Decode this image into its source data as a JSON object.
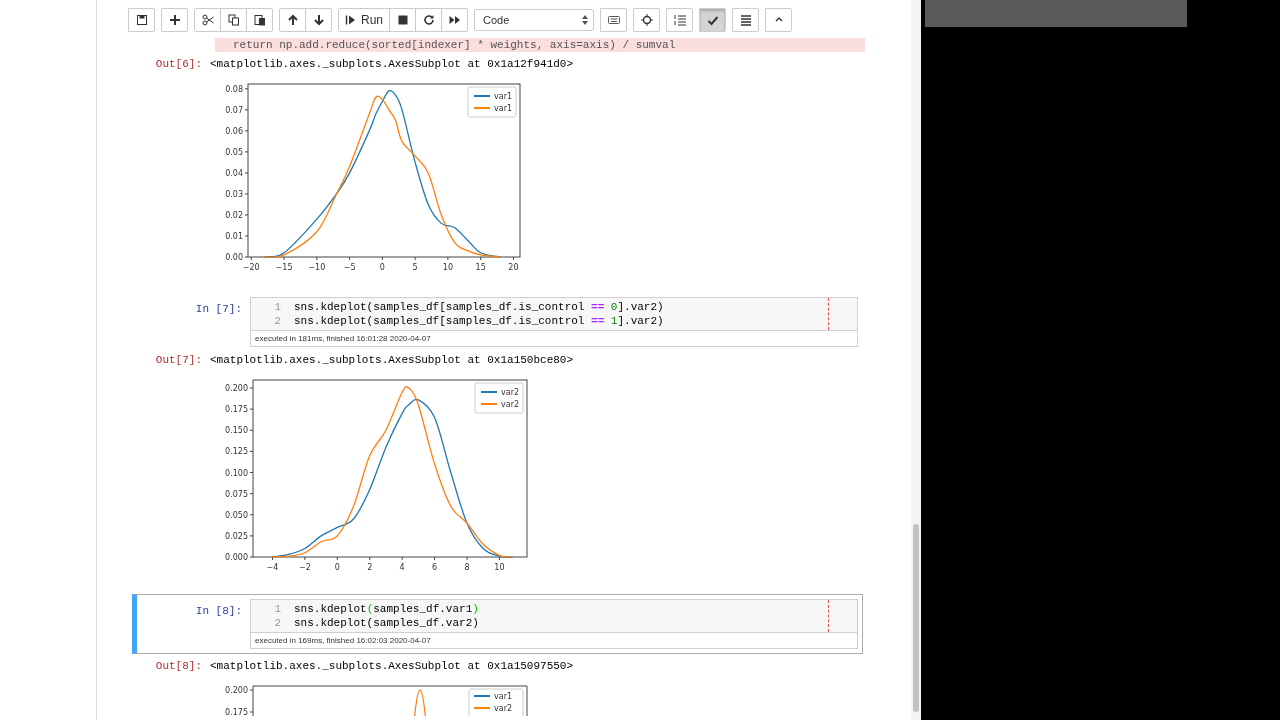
{
  "toolbar": {
    "groups": [
      {
        "buttons": [
          {
            "kind": "save",
            "active": false
          }
        ]
      },
      {
        "buttons": [
          {
            "kind": "add",
            "active": false
          }
        ]
      },
      {
        "buttons": [
          {
            "kind": "cut",
            "active": false
          },
          {
            "kind": "copy",
            "active": false
          },
          {
            "kind": "paste",
            "active": false
          }
        ]
      },
      {
        "buttons": [
          {
            "kind": "up",
            "active": false
          },
          {
            "kind": "down",
            "active": false
          }
        ]
      },
      {
        "buttons": [
          {
            "kind": "run",
            "label": "Run",
            "active": false
          },
          {
            "kind": "stop",
            "active": false
          },
          {
            "kind": "restart",
            "active": false
          },
          {
            "kind": "fast-forward",
            "active": false
          }
        ]
      }
    ],
    "cell_type": "Code",
    "extra_buttons": [
      {
        "kind": "keyboard",
        "active": false
      },
      {
        "kind": "crosshair",
        "active": false
      },
      {
        "kind": "list",
        "active": false
      },
      {
        "kind": "spellcheck",
        "active": true
      },
      {
        "kind": "toc",
        "active": false
      },
      {
        "kind": "collapse",
        "active": false
      }
    ]
  },
  "webcam": {
    "kind": "video"
  },
  "cells": [
    {
      "kind": "output",
      "warning": "return np.add.reduce(sorted[indexer] * weights, axis=axis) / sumval",
      "prompt": "Out[6]:",
      "text": "<matplotlib.axes._subplots.AxesSubplot at 0x1a12f941d0>",
      "chart_data": {
        "type": "line",
        "x": [
          -18,
          -15,
          -10,
          -7,
          -5,
          -2,
          -1,
          0,
          1,
          2,
          3,
          5,
          7,
          9,
          11,
          13,
          15,
          18
        ],
        "xlim": [
          -20.5,
          21
        ],
        "ylim": [
          0,
          0.0823
        ],
        "xticks": [
          -20,
          -15,
          -10,
          -5,
          0,
          5,
          10,
          15,
          20
        ],
        "yticks": [
          {
            "value": 0,
            "label": "0.00"
          },
          {
            "value": 0.01,
            "label": "0.01"
          },
          {
            "value": 0.02,
            "label": "0.02"
          },
          {
            "value": 0.03,
            "label": "0.03"
          },
          {
            "value": 0.04,
            "label": "0.04"
          },
          {
            "value": 0.05,
            "label": "0.05"
          },
          {
            "value": 0.06,
            "label": "0.06"
          },
          {
            "value": 0.07,
            "label": "0.07"
          },
          {
            "value": 0.08,
            "label": "0.08"
          }
        ],
        "series": [
          {
            "name": "var1",
            "color": "#1f77b4",
            "values": [
              0,
              0.002,
              0.018,
              0.03,
              0.04,
              0.06,
              0.068,
              0.074,
              0.079,
              0.077,
              0.07,
              0.045,
              0.025,
              0.016,
              0.014,
              0.008,
              0.002,
              0
            ]
          },
          {
            "name": "var1",
            "color": "#ff7f0e",
            "values": [
              0,
              0.001,
              0.012,
              0.03,
              0.043,
              0.068,
              0.076,
              0.075,
              0.07,
              0.065,
              0.055,
              0.048,
              0.04,
              0.02,
              0.007,
              0.003,
              0.001,
              0
            ]
          }
        ]
      }
    },
    {
      "kind": "code",
      "selected": false,
      "prompt": "In [7]:",
      "lines": [
        {
          "number": "1",
          "tokens": [
            {
              "kind": "plain",
              "text": "sns.kdeplot(samples_df[samples_df.is_control "
            },
            {
              "kind": "operator",
              "text": "=="
            },
            {
              "kind": "number",
              "text": " 0"
            },
            {
              "kind": "plain",
              "text": "].var2)"
            }
          ]
        },
        {
          "number": "2",
          "tokens": [
            {
              "kind": "plain",
              "text": "sns.kdeplot(samples_df[samples_df.is_control "
            },
            {
              "kind": "operator",
              "text": "=="
            },
            {
              "kind": "number",
              "text": " 1"
            },
            {
              "kind": "plain",
              "text": "].var2)"
            }
          ]
        }
      ],
      "execution": "executed in 181ms, finished 16:01:28 2020-04-07"
    },
    {
      "kind": "output",
      "prompt": "Out[7]:",
      "text": "<matplotlib.axes._subplots.AxesSubplot at 0x1a150bce80>",
      "chart_data": {
        "type": "line",
        "x": [
          -4,
          -3,
          -2,
          -1,
          0,
          1,
          2,
          3,
          4,
          4.4,
          5,
          6,
          7,
          8,
          9,
          10,
          10.8
        ],
        "xlim": [
          -5.2,
          11.7
        ],
        "ylim": [
          0,
          0.2095
        ],
        "xticks": [
          -4,
          -2,
          0,
          2,
          4,
          6,
          8,
          10
        ],
        "yticks": [
          {
            "value": 0,
            "label": "0.000"
          },
          {
            "value": 0.025,
            "label": "0.025"
          },
          {
            "value": 0.05,
            "label": "0.050"
          },
          {
            "value": 0.075,
            "label": "0.075"
          },
          {
            "value": 0.1,
            "label": "0.100"
          },
          {
            "value": 0.125,
            "label": "0.125"
          },
          {
            "value": 0.15,
            "label": "0.150"
          },
          {
            "value": 0.175,
            "label": "0.175"
          },
          {
            "value": 0.2,
            "label": "0.200"
          }
        ],
        "series": [
          {
            "name": "var2",
            "color": "#1f77b4",
            "values": [
              0,
              0.003,
              0.01,
              0.025,
              0.035,
              0.045,
              0.08,
              0.13,
              0.17,
              0.18,
              0.186,
              0.165,
              0.1,
              0.04,
              0.01,
              0.001,
              0
            ]
          },
          {
            "name": "var2",
            "color": "#ff7f0e",
            "values": [
              0,
              0.001,
              0.005,
              0.018,
              0.025,
              0.06,
              0.12,
              0.15,
              0.195,
              0.2,
              0.18,
              0.11,
              0.06,
              0.04,
              0.015,
              0.002,
              0
            ]
          }
        ]
      }
    },
    {
      "kind": "code",
      "selected": true,
      "prompt": "In [8]:",
      "lines": [
        {
          "number": "1",
          "tokens": [
            {
              "kind": "plain",
              "text": "sns.kdeplot"
            },
            {
              "kind": "bracket",
              "text": "("
            },
            {
              "kind": "plain",
              "text": "samples_df.var1"
            },
            {
              "kind": "bracket",
              "text": ")"
            }
          ]
        },
        {
          "number": "2",
          "tokens": [
            {
              "kind": "plain",
              "text": "sns.kdeplot(samples_df.var2)"
            }
          ]
        }
      ],
      "execution": "executed in 169ms, finished 16:02:03 2020-04-07"
    },
    {
      "kind": "output",
      "prompt": "Out[8]:",
      "text": "<matplotlib.axes._subplots.AxesSubplot at 0x1a15097550>",
      "partial_plot": {
        "yticks": [
          "0.200",
          "0.175"
        ],
        "legend": [
          {
            "label": "var1",
            "color": "#1f77b4"
          },
          {
            "label": "var2",
            "color": "#ff7f0e"
          }
        ]
      }
    }
  ]
}
